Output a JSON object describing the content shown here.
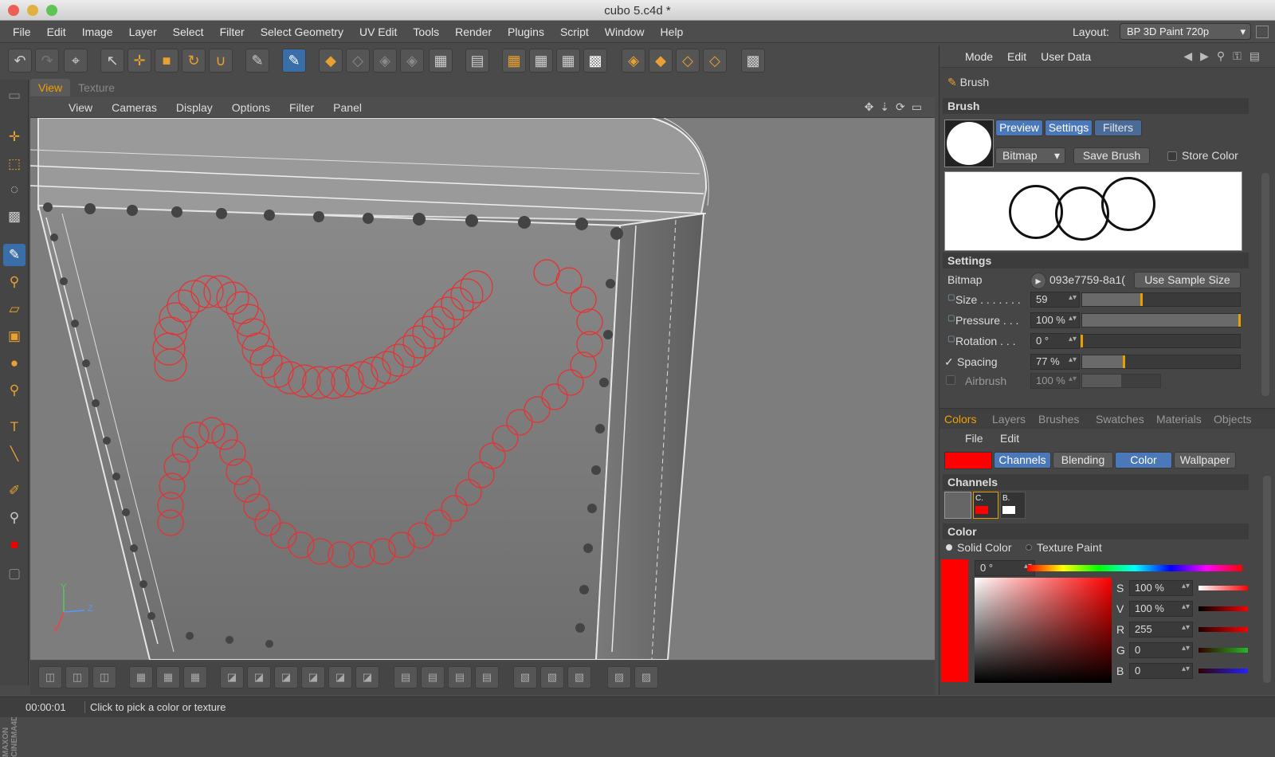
{
  "window": {
    "title": "cubo 5.c4d *"
  },
  "menubar": {
    "items": [
      "File",
      "Edit",
      "Image",
      "Layer",
      "Select",
      "Filter",
      "Select Geometry",
      "UV Edit",
      "Tools",
      "Render",
      "Plugins",
      "Script",
      "Window",
      "Help"
    ],
    "layout_label": "Layout:",
    "layout_value": "BP 3D Paint 720p"
  },
  "viewport": {
    "tabs": [
      "View",
      "Texture"
    ],
    "menu": [
      "View",
      "Cameras",
      "Display",
      "Options",
      "Filter",
      "Panel"
    ],
    "axis_y": "Y",
    "axis_x": "X",
    "axis_z": "Z"
  },
  "leftbar": {
    "brand": "MAXON CINEMA4D"
  },
  "status": {
    "time": "00:00:01",
    "message": "Click to pick a color or texture"
  },
  "attributes": {
    "modebar": [
      "Mode",
      "Edit",
      "User Data"
    ],
    "brush_header": "Brush",
    "section_brush": "Brush",
    "btn_preview": "Preview",
    "btn_settings": "Settings",
    "btn_filters": "Filters",
    "bitmap_select": "Bitmap",
    "save_brush": "Save Brush",
    "store_color": "Store Color",
    "section_settings": "Settings",
    "bitmap_label": "Bitmap",
    "bitmap_value": "093e7759-8a1(",
    "use_sample_size": "Use Sample Size",
    "rows": [
      {
        "label": "Size . . . . . . .",
        "value": "59",
        "level": 0.38
      },
      {
        "label": "Pressure . . .",
        "value": "100 %",
        "level": 1.0
      },
      {
        "label": "Rotation . . .",
        "value": "0 °",
        "level": 0.0
      },
      {
        "label": "Spacing",
        "value": "77 %",
        "level": 0.27
      },
      {
        "label": "Airbrush",
        "value": "100 %",
        "level": 0.5
      }
    ]
  },
  "colors_panel": {
    "tabs": [
      "Colors",
      "Layers",
      "Brushes",
      "Swatches",
      "Materials",
      "Objects"
    ],
    "menu": [
      "File",
      "Edit"
    ],
    "sub_tabs": [
      "Channels",
      "Blending",
      "Color",
      "Wallpaper"
    ],
    "section_channels": "Channels",
    "channel_c": "C.",
    "channel_b": "B.",
    "section_color": "Color",
    "solid_color": "Solid Color",
    "texture_paint": "Texture Paint",
    "hue_value": "0 °",
    "s_label": "S",
    "s_value": "100 %",
    "v_label": "V",
    "v_value": "100 %",
    "r_label": "R",
    "r_value": "255",
    "g_label": "G",
    "g_value": "0",
    "b_label": "B",
    "b_value": "0",
    "current_color": "#ff0000"
  }
}
